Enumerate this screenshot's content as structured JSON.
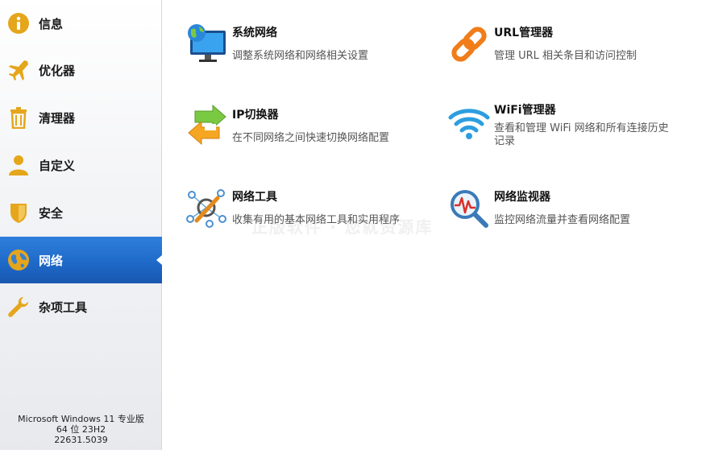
{
  "sidebar": {
    "items": [
      {
        "label": "信息",
        "icon": "info-icon"
      },
      {
        "label": "优化器",
        "icon": "airplane-icon"
      },
      {
        "label": "清理器",
        "icon": "trash-icon"
      },
      {
        "label": "自定义",
        "icon": "user-icon"
      },
      {
        "label": "安全",
        "icon": "shield-icon"
      },
      {
        "label": "网络",
        "icon": "globe-icon",
        "active": true
      },
      {
        "label": "杂项工具",
        "icon": "wrench-icon"
      }
    ],
    "system_info": {
      "line1": "Microsoft Windows 11 专业版",
      "line2": "64 位 23H2",
      "line3": "22631.5039"
    }
  },
  "tools": {
    "system_network": {
      "title": "系统网络",
      "desc": "调整系统网络和网络相关设置",
      "icon": "monitor-globe-icon"
    },
    "url_manager": {
      "title": "URL管理器",
      "desc": "管理 URL 相关条目和访问控制",
      "icon": "chain-link-icon"
    },
    "ip_switcher": {
      "title": "IP切换器",
      "desc": "在不同网络之间快速切换网络配置",
      "icon": "switch-arrows-icon"
    },
    "wifi_manager": {
      "title": "WiFi管理器",
      "desc": "查看和管理 WiFi 网络和所有连接历史记录",
      "icon": "wifi-icon"
    },
    "network_tools": {
      "title": "网络工具",
      "desc": "收集有用的基本网络工具和实用程序",
      "icon": "network-tools-icon"
    },
    "network_monitor": {
      "title": "网络监视器",
      "desc": "监控网络流量并查看网络配置",
      "icon": "magnifier-pulse-icon"
    }
  },
  "watermark": "正版软件 · 您就资源库",
  "colors": {
    "accent": "#1f6ac9",
    "icon_gold": "#e5a61c",
    "icon_orange": "#f07d1a",
    "icon_blue": "#2c9ee0"
  }
}
